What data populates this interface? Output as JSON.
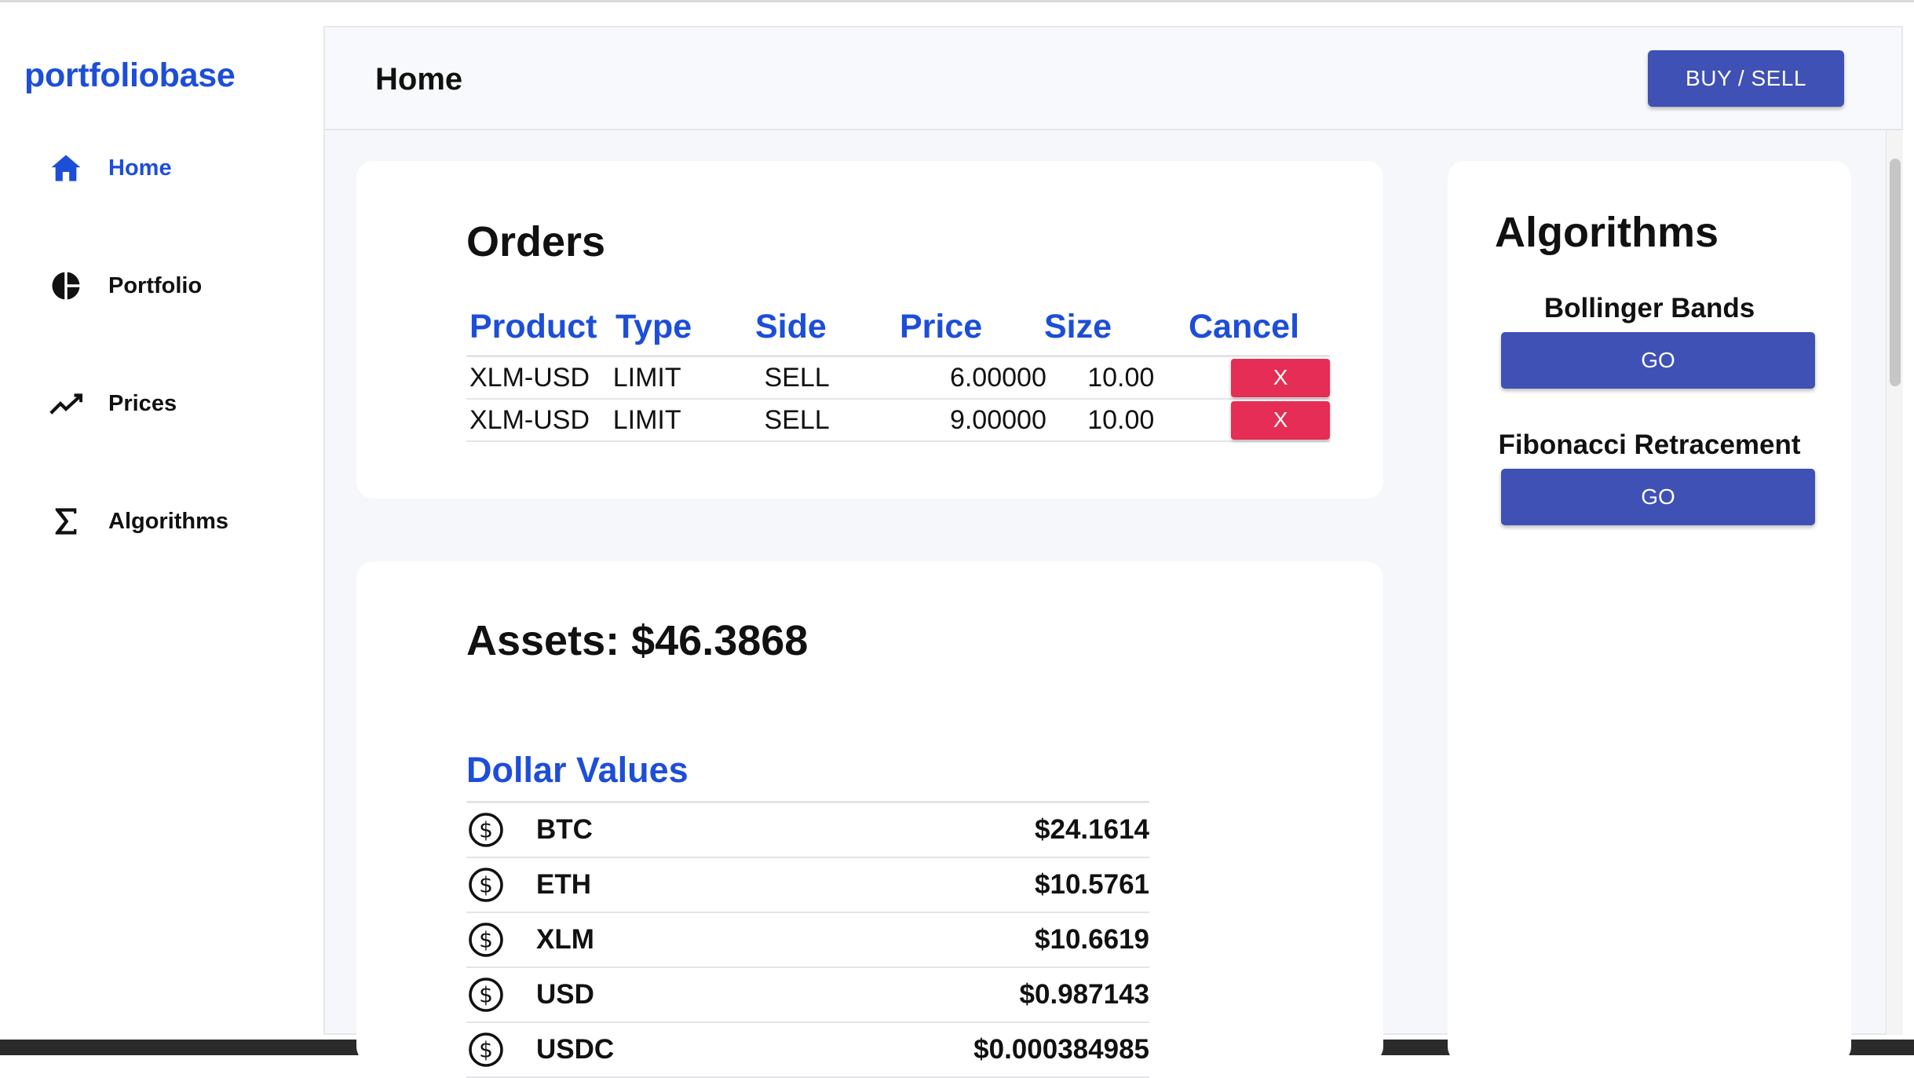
{
  "sidebar": {
    "brand": "portfoliobase",
    "items": [
      {
        "label": "Home",
        "icon": "home-icon",
        "active": true
      },
      {
        "label": "Portfolio",
        "icon": "pie-chart-icon"
      },
      {
        "label": "Prices",
        "icon": "trend-line-icon"
      },
      {
        "label": "Algorithms",
        "icon": "sigma-icon"
      }
    ]
  },
  "header": {
    "title": "Home",
    "buy_sell_label": "BUY / SELL"
  },
  "orders": {
    "title": "Orders",
    "columns": [
      "Product",
      "Type",
      "Side",
      "Price",
      "Size",
      "Cancel"
    ],
    "rows": [
      {
        "product": "XLM-USD",
        "type": "LIMIT",
        "side": "SELL",
        "price": "6.00000",
        "size": "10.00",
        "cancel": "X"
      },
      {
        "product": "XLM-USD",
        "type": "LIMIT",
        "side": "SELL",
        "price": "9.00000",
        "size": "10.00",
        "cancel": "X"
      }
    ]
  },
  "assets": {
    "title": "Assets: $46.3868",
    "section": "Dollar Values",
    "rows": [
      {
        "symbol": "BTC",
        "value": "$24.1614"
      },
      {
        "symbol": "ETH",
        "value": "$10.5761"
      },
      {
        "symbol": "XLM",
        "value": "$10.6619"
      },
      {
        "symbol": "USD",
        "value": "$0.987143"
      },
      {
        "symbol": "USDC",
        "value": "$0.000384985"
      }
    ]
  },
  "algorithms": {
    "title": "Algorithms",
    "items": [
      {
        "name": "Bollinger Bands",
        "button": "GO"
      },
      {
        "name": "Fibonacci Retracement",
        "button": "GO"
      }
    ]
  },
  "colors": {
    "brand": "#1d4ed8",
    "primary_button": "#3f51b5",
    "danger_button": "#e52d55"
  }
}
